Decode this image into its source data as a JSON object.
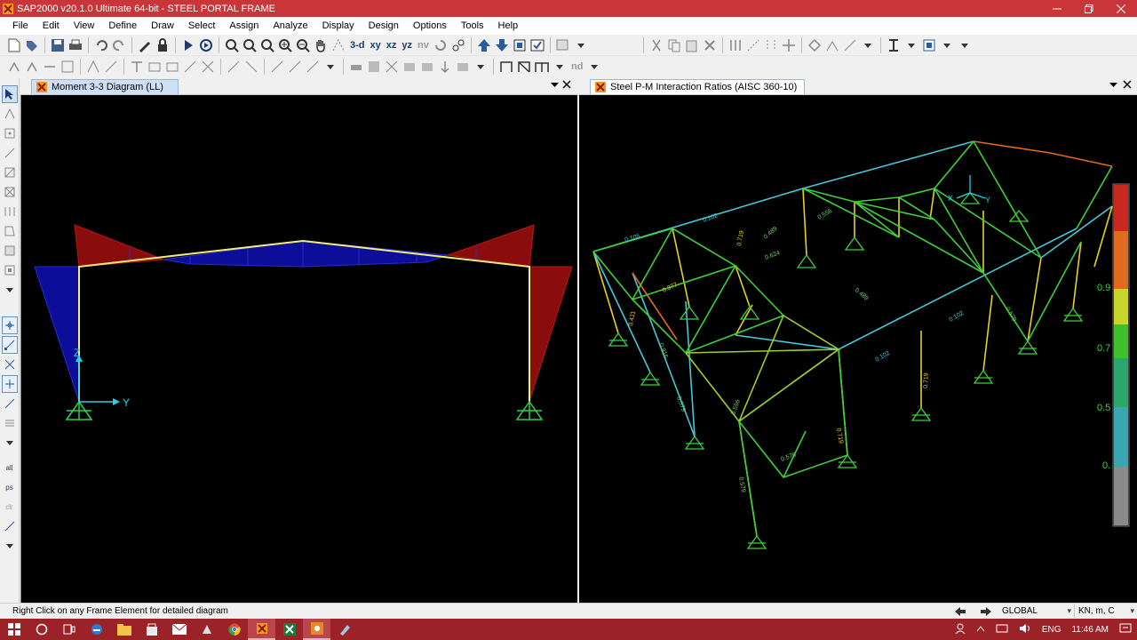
{
  "window": {
    "title": "SAP2000 v20.1.0 Ultimate 64-bit - STEEL PORTAL FRAME",
    "controls": [
      "minimize-icon",
      "maximize-icon",
      "close-icon"
    ]
  },
  "menu": [
    "File",
    "Edit",
    "View",
    "Define",
    "Draw",
    "Select",
    "Assign",
    "Analyze",
    "Display",
    "Design",
    "Options",
    "Tools",
    "Help"
  ],
  "toolbar": {
    "view_3d": "3-d",
    "view_xy": "xy",
    "view_xz": "xz",
    "view_yz": "yz",
    "view_nv": "nv",
    "nd_label": "nd"
  },
  "left_pane": {
    "tab_title": "Moment 3-3 Diagram (LL)",
    "axis_z": "Z",
    "axis_y": "Y"
  },
  "right_pane": {
    "tab_title": "Steel P-M Interaction Ratios  (AISC 360-10)",
    "legend_ticks": [
      "0.9",
      "0.7",
      "0.5",
      "0."
    ],
    "legend_colors": [
      "#c8281e",
      "#e06a1e",
      "#e7d21f",
      "#c6d72a",
      "#3fbf2a",
      "#2aa86c",
      "#3aa6b0",
      "#8a8a8a"
    ],
    "axis_x": "X",
    "axis_y": "Y",
    "ratio_labels": [
      "0.102",
      "0.105",
      "0.719",
      "0.489",
      "0.624",
      "0.556",
      "0.377",
      "0.411",
      "0.916",
      "0.579",
      "0.556",
      "0.579",
      "0.719",
      "0.102",
      "0.489",
      "0.719",
      "0.102",
      "0.576",
      "0.579"
    ]
  },
  "status": {
    "text": "Right Click on any Frame Element for detailed diagram",
    "coord_system": "GLOBAL",
    "units": "KN, m, C"
  },
  "taskbar": {
    "language": "ENG",
    "time": "11:46 AM"
  }
}
